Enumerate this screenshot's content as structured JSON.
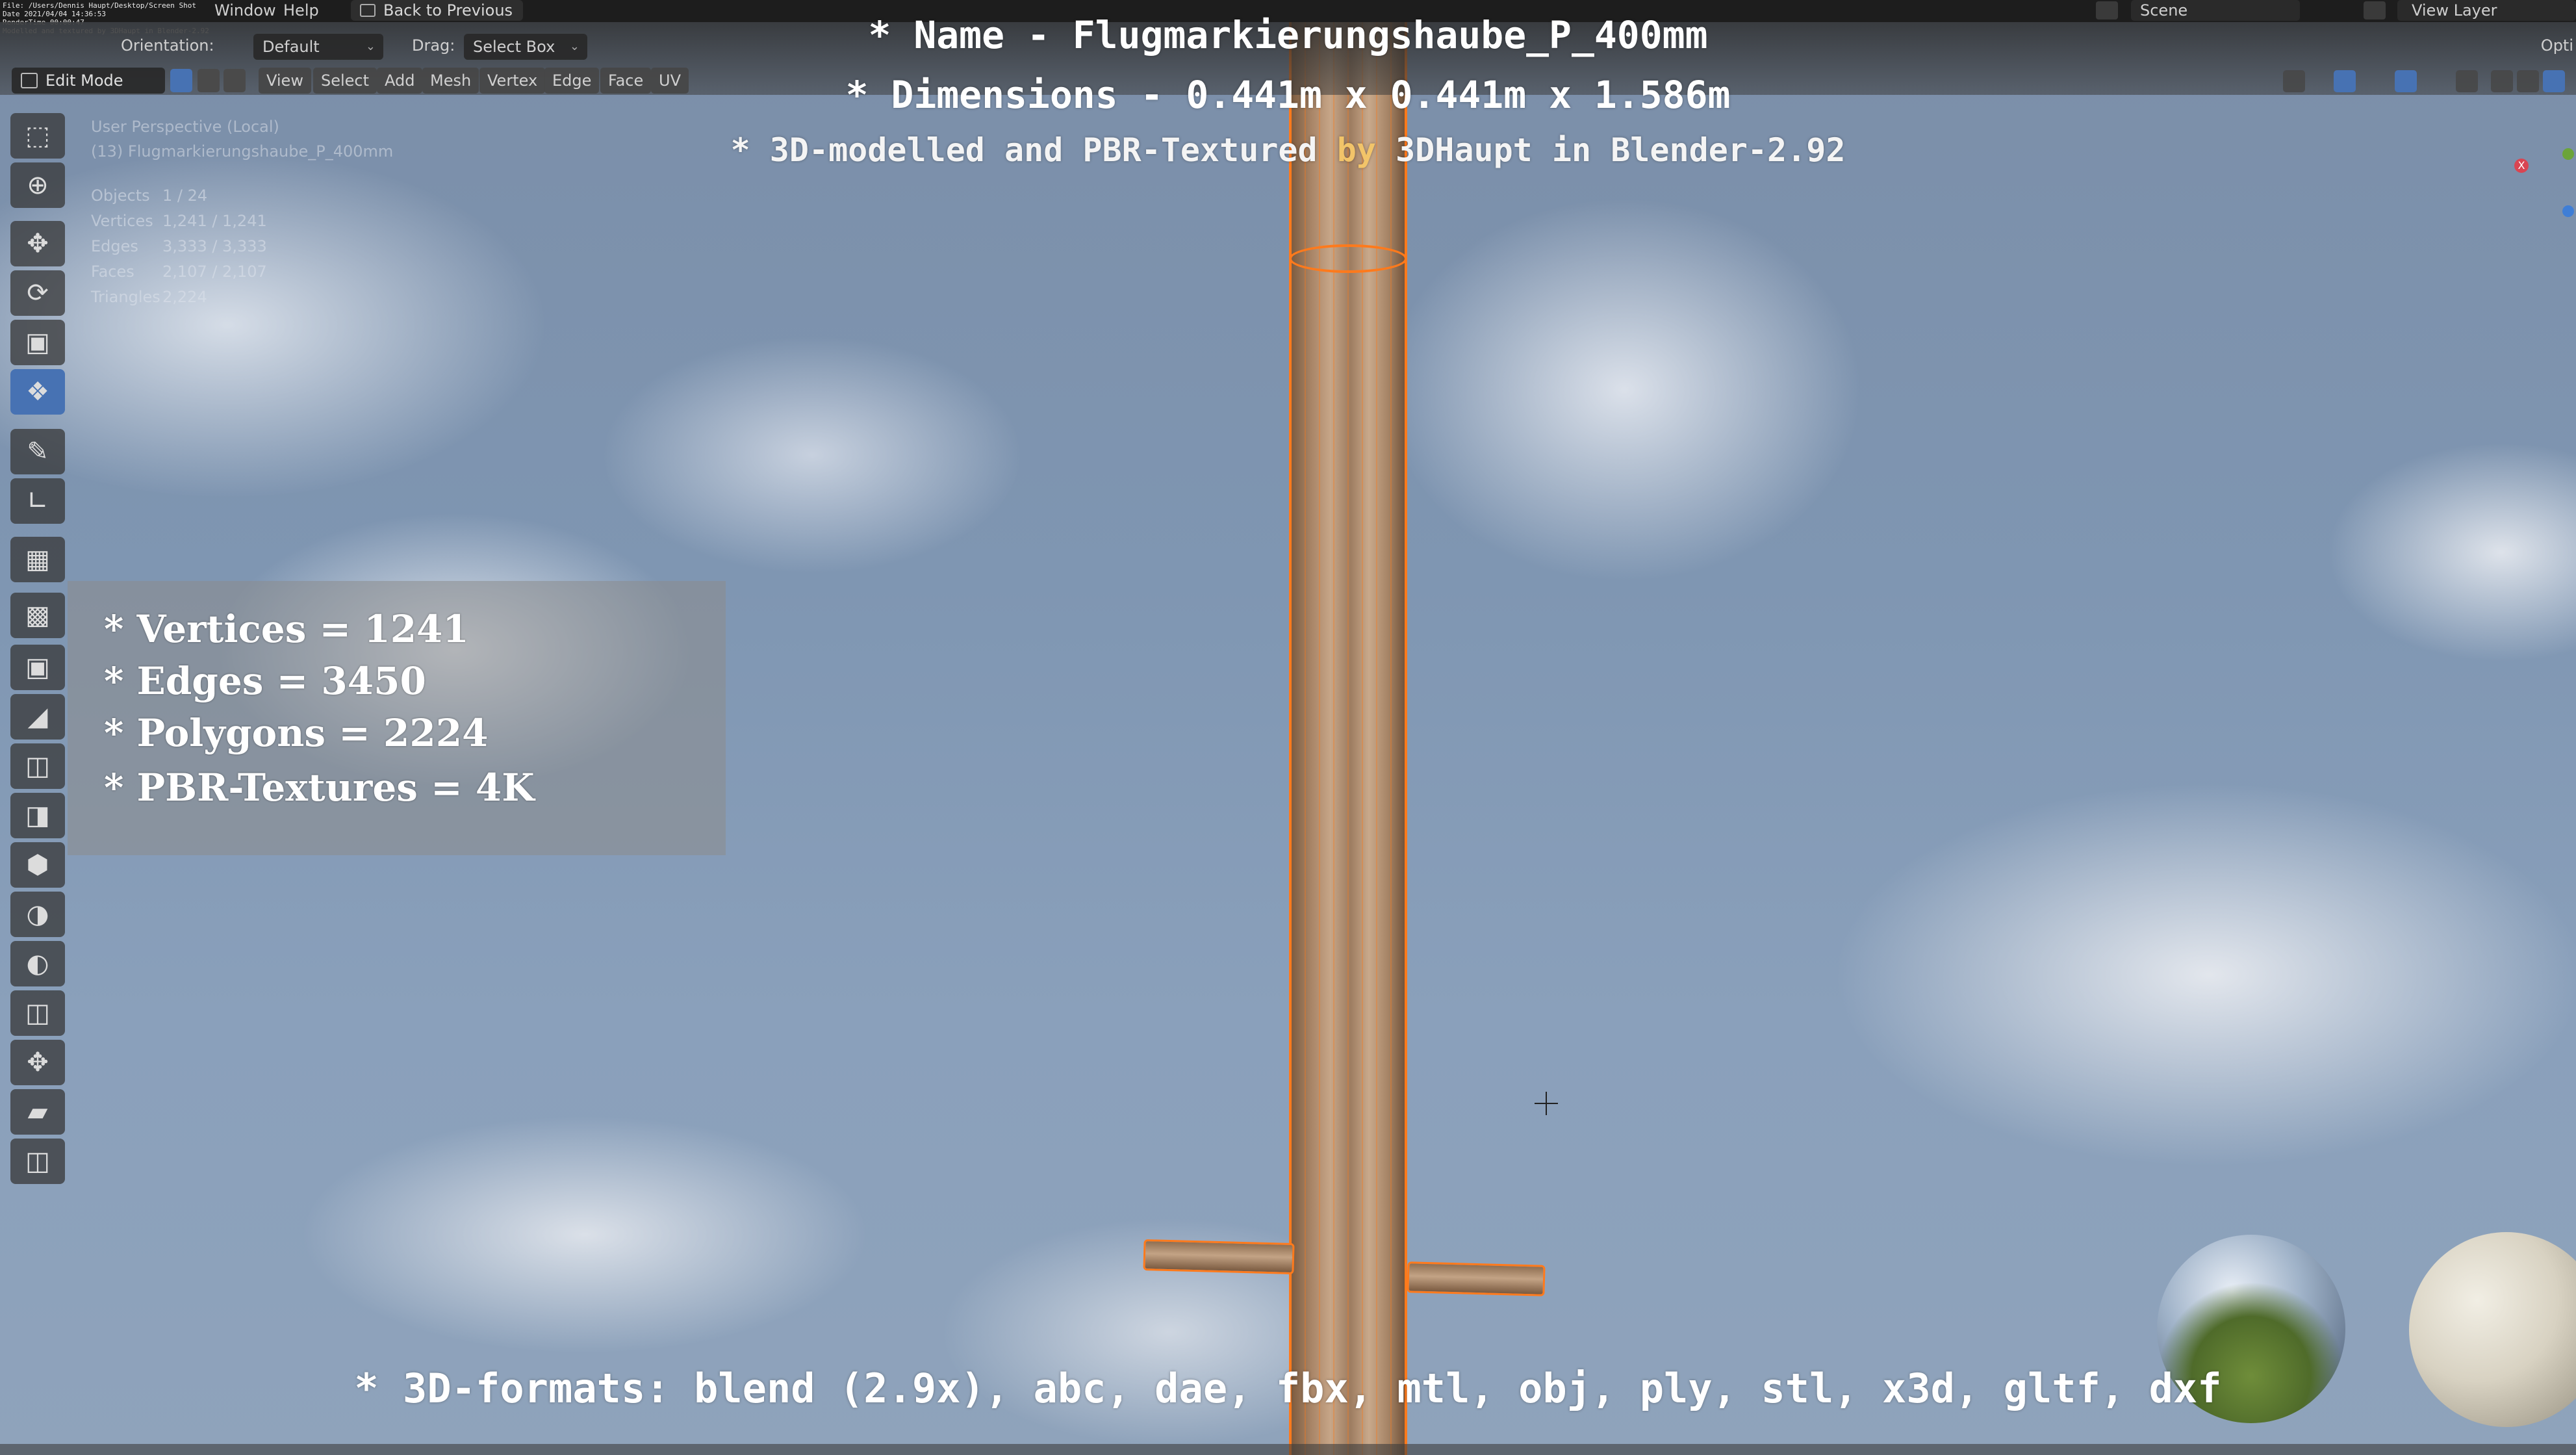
{
  "topbar": {
    "debug_text": "File: /Users/Dennis Haupt/Desktop/Screen Shot\nDate 2021/04/04 14:36:53\nRenderTime 00:00:47\nModelled and textured by 3DHaupt in Blender-2.92",
    "menu_window": "Window",
    "menu_help": "Help",
    "back_button": "Back to Previous",
    "scene_label": "Scene",
    "view_layer_label": "View Layer"
  },
  "header": {
    "orientation_label": "Orientation:",
    "orientation_value": "Default",
    "drag_label": "Drag:",
    "drag_value": "Select Box",
    "mode": "Edit Mode",
    "menus": [
      "View",
      "Select",
      "Add",
      "Mesh",
      "Vertex",
      "Edge",
      "Face",
      "UV"
    ],
    "options_label": "Opti"
  },
  "viewport_info": {
    "perspective": "User Perspective (Local)",
    "object": "(13) Flugmarkierungshaube_P_400mm",
    "objects_label": "Objects",
    "objects_value": "1 / 24",
    "vertices_label": "Vertices",
    "vertices_value": "1,241 / 1,241",
    "edges_label": "Edges",
    "edges_value": "3,333 / 3,333",
    "faces_label": "Faces",
    "faces_value": "2,107 / 2,107",
    "triangles_label": "Triangles",
    "triangles_value": "2,224"
  },
  "overlay": {
    "name_line": "* Name - Flugmarkierungshaube_P_400mm",
    "dimensions_line": "* Dimensions -  0.441m x 0.441m x 1.586m",
    "credit_before": "* 3D-modelled and PBR-Textured ",
    "credit_by": "by",
    "credit_after": " 3DHaupt in Blender-2.92",
    "stats": [
      "* Vertices = 1241",
      "* Edges = 3450",
      "* Polygons = 2224",
      "* PBR-Textures = 4K"
    ],
    "formats_line": "* 3D-formats: blend (2.9x), abc, dae, fbx, mtl, obj, ply, stl, x3d, gltf, dxf"
  },
  "gizmo": {
    "x_label": "X"
  },
  "colors": {
    "selection_orange": "#ff7a1c",
    "active_tool_blue": "#4772b3",
    "credit_by_color": "#f2c469"
  },
  "icons": [
    "select-box-icon",
    "cursor-icon",
    "move-icon",
    "rotate-icon",
    "scale-icon",
    "transform-icon",
    "annotate-icon",
    "measure-icon",
    "add-cube-icon",
    "extrude-icon",
    "inset-icon",
    "bevel-icon",
    "loop-cut-icon",
    "knife-icon",
    "poly-build-icon",
    "spin-icon",
    "smooth-icon",
    "edge-slide-icon",
    "shrink-fatten-icon",
    "shear-icon",
    "rip-icon"
  ]
}
